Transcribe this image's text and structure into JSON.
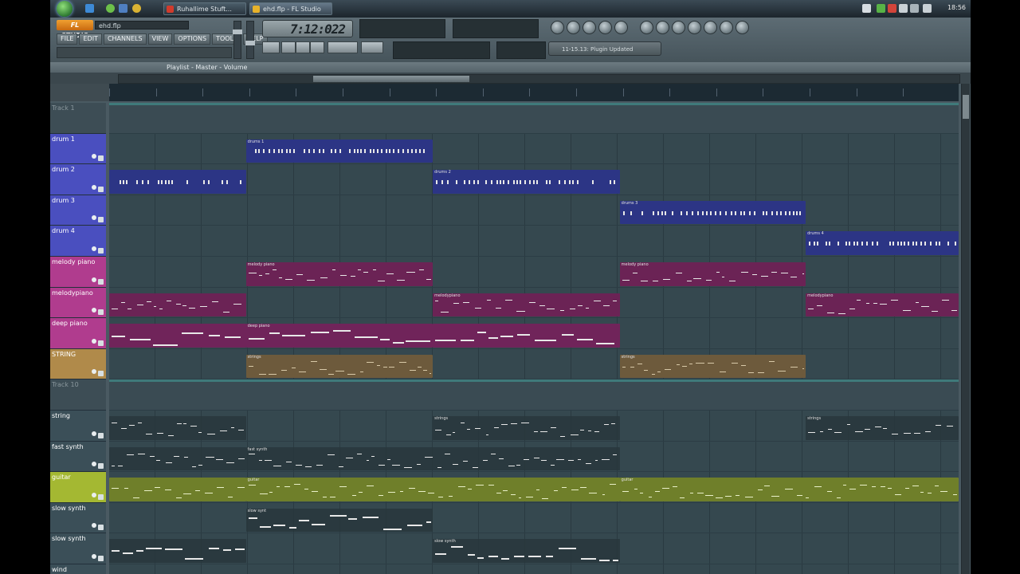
{
  "taskbar": {
    "tasks": [
      {
        "label": "Ruhallime Stuft..."
      },
      {
        "label": "ehd.flp - FL Studio"
      }
    ],
    "clock": "18:56"
  },
  "toolbar": {
    "logo": "FL STUDIO",
    "project_name": "ehd.flp",
    "menu": [
      "FILE",
      "EDIT",
      "CHANNELS",
      "VIEW",
      "OPTIONS",
      "TOOLS",
      "HELP"
    ],
    "time_display": "7:12:022",
    "hint_text": "11-15.13: Plugin Updated"
  },
  "playlist": {
    "title": "Playlist - Master - Volume",
    "tracks": [
      {
        "name": "Track 1",
        "color": "#3d4d55",
        "type": "separator"
      },
      {
        "name": "drum 1",
        "color": "#4a4fbf"
      },
      {
        "name": "drum 2",
        "color": "#4a4fbf"
      },
      {
        "name": "drum 3",
        "color": "#4a4fbf"
      },
      {
        "name": "drum 4",
        "color": "#4a4fbf"
      },
      {
        "name": "melody piano",
        "color": "#b03c8e"
      },
      {
        "name": "melodypiano",
        "color": "#b03c8e"
      },
      {
        "name": "deep piano",
        "color": "#b03c8e"
      },
      {
        "name": "STRING",
        "color": "#b08a4a"
      },
      {
        "name": "Track 10",
        "color": "#3d4d55",
        "type": "separator"
      },
      {
        "name": "string",
        "color": "#3b4f58"
      },
      {
        "name": "fast synth",
        "color": "#3b4f58"
      },
      {
        "name": "guitar",
        "color": "#a4b832"
      },
      {
        "name": "slow synth",
        "color": "#3b4f58"
      },
      {
        "name": "slow synth",
        "color": "#3b4f58"
      },
      {
        "name": "wind",
        "color": "#3b4f58"
      }
    ],
    "clips": [
      {
        "track": 1,
        "label": "drums 1",
        "kind": "drum",
        "start": 0.161,
        "end": 0.381
      },
      {
        "track": 2,
        "label": "",
        "kind": "drum",
        "start": 0.0,
        "end": 0.161
      },
      {
        "track": 2,
        "label": "drums 2",
        "kind": "drum",
        "start": 0.381,
        "end": 0.601
      },
      {
        "track": 3,
        "label": "drums 3",
        "kind": "drum",
        "start": 0.601,
        "end": 0.82
      },
      {
        "track": 4,
        "label": "drums 4",
        "kind": "drum",
        "start": 0.82,
        "end": 1.0
      },
      {
        "track": 5,
        "label": "melody piano",
        "kind": "piano",
        "start": 0.161,
        "end": 0.381
      },
      {
        "track": 5,
        "label": "melody piano",
        "kind": "piano",
        "start": 0.601,
        "end": 0.82
      },
      {
        "track": 6,
        "label": "",
        "kind": "piano",
        "start": 0.0,
        "end": 0.161
      },
      {
        "track": 6,
        "label": "melodypiano",
        "kind": "piano",
        "start": 0.381,
        "end": 0.601
      },
      {
        "track": 6,
        "label": "melodypiano",
        "kind": "piano",
        "start": 0.82,
        "end": 1.0
      },
      {
        "track": 7,
        "label": "",
        "kind": "deep",
        "start": 0.0,
        "end": 0.161
      },
      {
        "track": 7,
        "label": "deep piano",
        "kind": "deep",
        "start": 0.161,
        "end": 0.381
      },
      {
        "track": 7,
        "label": "",
        "kind": "deep",
        "start": 0.381,
        "end": 0.601
      },
      {
        "track": 8,
        "label": "strings",
        "kind": "string",
        "start": 0.161,
        "end": 0.381
      },
      {
        "track": 8,
        "label": "strings",
        "kind": "string",
        "start": 0.601,
        "end": 0.82
      },
      {
        "track": 10,
        "label": "",
        "kind": "synth",
        "start": 0.0,
        "end": 0.161
      },
      {
        "track": 10,
        "label": "strings",
        "kind": "synth",
        "start": 0.381,
        "end": 0.601
      },
      {
        "track": 10,
        "label": "strings",
        "kind": "synth",
        "start": 0.82,
        "end": 1.0
      },
      {
        "track": 11,
        "label": "",
        "kind": "synth",
        "start": 0.0,
        "end": 0.161
      },
      {
        "track": 11,
        "label": "fast synth",
        "kind": "synth",
        "start": 0.161,
        "end": 0.601
      },
      {
        "track": 12,
        "label": "",
        "kind": "guitar",
        "start": 0.0,
        "end": 0.161
      },
      {
        "track": 12,
        "label": "guitar",
        "kind": "guitar",
        "start": 0.161,
        "end": 0.601
      },
      {
        "track": 12,
        "label": "guitar",
        "kind": "guitar",
        "start": 0.601,
        "end": 1.0
      },
      {
        "track": 13,
        "label": "slow synt",
        "kind": "synth",
        "start": 0.161,
        "end": 0.381
      },
      {
        "track": 14,
        "label": "",
        "kind": "synth",
        "start": 0.0,
        "end": 0.161
      },
      {
        "track": 14,
        "label": "slow synth",
        "kind": "synth",
        "start": 0.381,
        "end": 0.601
      }
    ]
  },
  "colors": {
    "drum_clip": "#2c3585",
    "piano_clip": "#6b2355",
    "deep_clip": "#70245a",
    "string_clip": "#6d5a3c",
    "synth_clip": "#2f3e44",
    "guitar_clip": "#6f7f2a"
  }
}
